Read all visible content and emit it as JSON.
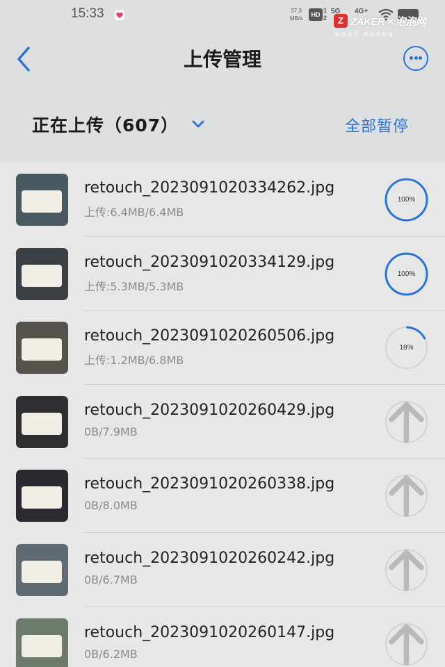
{
  "status_bar": {
    "time": "15:33",
    "speed_value": "37.3",
    "speed_unit": "MB/s",
    "hd_label": "HD",
    "sim_1": "1",
    "sim_2": "2",
    "net_1": "5G",
    "net_2": "4G+",
    "icons": [
      "heart-icon",
      "wifi-icon",
      "battery-icon"
    ]
  },
  "watermark": {
    "logo_letter": "Z",
    "text": "ZAKER × 泡泡网",
    "subtext": "微信关注·随机有惊喜"
  },
  "header": {
    "title": "上传管理",
    "back_icon": "chevron-left-icon",
    "more_icon": "more-icon"
  },
  "filter": {
    "label": "正在上传（607）",
    "pause_all": "全部暂停"
  },
  "colors": {
    "accent": "#2b73d3",
    "ring_track": "#cdcdcd",
    "background": "#e7e7e7",
    "header_background": "#dedfe0"
  },
  "uploads": [
    {
      "name": "retouch_2023091020334262.jpg",
      "progress": "上传:6.4MB/6.4MB",
      "percent": 100,
      "percent_label": "100%",
      "state": "uploading"
    },
    {
      "name": "retouch_2023091020334129.jpg",
      "progress": "上传:5.3MB/5.3MB",
      "percent": 100,
      "percent_label": "100%",
      "state": "uploading"
    },
    {
      "name": "retouch_2023091020260506.jpg",
      "progress": "上传:1.2MB/6.8MB",
      "percent": 18,
      "percent_label": "18%",
      "state": "uploading"
    },
    {
      "name": "retouch_2023091020260429.jpg",
      "progress": "0B/7.9MB",
      "percent": 0,
      "percent_label": "",
      "state": "waiting"
    },
    {
      "name": "retouch_2023091020260338.jpg",
      "progress": "0B/8.0MB",
      "percent": 0,
      "percent_label": "",
      "state": "waiting"
    },
    {
      "name": "retouch_2023091020260242.jpg",
      "progress": "0B/6.7MB",
      "percent": 0,
      "percent_label": "",
      "state": "waiting"
    },
    {
      "name": "retouch_2023091020260147.jpg",
      "progress": "0B/6.2MB",
      "percent": 0,
      "percent_label": "",
      "state": "waiting"
    }
  ]
}
